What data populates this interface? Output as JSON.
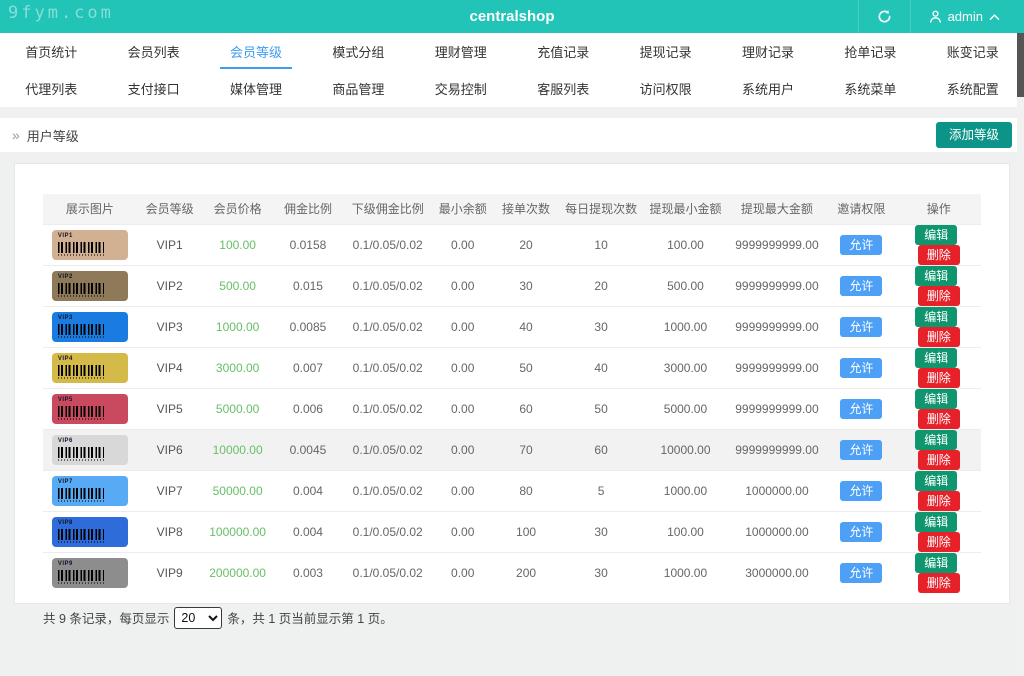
{
  "header": {
    "watermark": "9fym.com",
    "title": "centralshop",
    "user": "admin",
    "brand_color": "#21c4b7"
  },
  "nav": {
    "row1": [
      "首页统计",
      "会员列表",
      "会员等级",
      "模式分组",
      "理财管理",
      "充值记录",
      "提现记录",
      "理财记录",
      "抢单记录",
      "账变记录"
    ],
    "row2": [
      "代理列表",
      "支付接口",
      "媒体管理",
      "商品管理",
      "交易控制",
      "客服列表",
      "访问权限",
      "系统用户",
      "系统菜单",
      "系统配置"
    ],
    "active": "会员等级",
    "active_color": "#3e9ef0"
  },
  "breadcrumb": {
    "marker": "»",
    "label": "用户等级"
  },
  "toolbar": {
    "add_button": "添加等级",
    "add_button_color": "#0d9488"
  },
  "table": {
    "columns": [
      "展示图片",
      "会员等级",
      "会员价格",
      "佣金比例",
      "下级佣金比例",
      "最小余额",
      "接单次数",
      "每日提现次数",
      "提现最小金额",
      "提现最大金额",
      "邀请权限",
      "操作"
    ],
    "actions": {
      "invite": "允许",
      "edit": "编辑",
      "delete": "删除"
    },
    "action_colors": {
      "invite": "#4da0f5",
      "edit": "#10966f",
      "delete": "#e62129"
    },
    "price_color": "#67bf67",
    "rows": [
      {
        "level": "VIP1",
        "price": "100.00",
        "commission": "0.0158",
        "sub_commission": "0.1/0.05/0.02",
        "min_balance": "0.00",
        "orders": "20",
        "daily_withdraw": "10",
        "min_withdraw": "100.00",
        "max_withdraw": "9999999999.00",
        "card_color": "#d2b193",
        "highlight": false
      },
      {
        "level": "VIP2",
        "price": "500.00",
        "commission": "0.015",
        "sub_commission": "0.1/0.05/0.02",
        "min_balance": "0.00",
        "orders": "30",
        "daily_withdraw": "20",
        "min_withdraw": "500.00",
        "max_withdraw": "9999999999.00",
        "card_color": "#8e7a58",
        "highlight": false
      },
      {
        "level": "VIP3",
        "price": "1000.00",
        "commission": "0.0085",
        "sub_commission": "0.1/0.05/0.02",
        "min_balance": "0.00",
        "orders": "40",
        "daily_withdraw": "30",
        "min_withdraw": "1000.00",
        "max_withdraw": "9999999999.00",
        "card_color": "#1a7ce0",
        "highlight": false
      },
      {
        "level": "VIP4",
        "price": "3000.00",
        "commission": "0.007",
        "sub_commission": "0.1/0.05/0.02",
        "min_balance": "0.00",
        "orders": "50",
        "daily_withdraw": "40",
        "min_withdraw": "3000.00",
        "max_withdraw": "9999999999.00",
        "card_color": "#d4ba49",
        "highlight": false
      },
      {
        "level": "VIP5",
        "price": "5000.00",
        "commission": "0.006",
        "sub_commission": "0.1/0.05/0.02",
        "min_balance": "0.00",
        "orders": "60",
        "daily_withdraw": "50",
        "min_withdraw": "5000.00",
        "max_withdraw": "9999999999.00",
        "card_color": "#c94a5e",
        "highlight": false
      },
      {
        "level": "VIP6",
        "price": "10000.00",
        "commission": "0.0045",
        "sub_commission": "0.1/0.05/0.02",
        "min_balance": "0.00",
        "orders": "70",
        "daily_withdraw": "60",
        "min_withdraw": "10000.00",
        "max_withdraw": "9999999999.00",
        "card_color": "#d8d8d8",
        "highlight": true
      },
      {
        "level": "VIP7",
        "price": "50000.00",
        "commission": "0.004",
        "sub_commission": "0.1/0.05/0.02",
        "min_balance": "0.00",
        "orders": "80",
        "daily_withdraw": "5",
        "min_withdraw": "1000.00",
        "max_withdraw": "1000000.00",
        "card_color": "#58aaf4",
        "highlight": false
      },
      {
        "level": "VIP8",
        "price": "100000.00",
        "commission": "0.004",
        "sub_commission": "0.1/0.05/0.02",
        "min_balance": "0.00",
        "orders": "100",
        "daily_withdraw": "30",
        "min_withdraw": "100.00",
        "max_withdraw": "1000000.00",
        "card_color": "#2d6cd9",
        "highlight": false
      },
      {
        "level": "VIP9",
        "price": "200000.00",
        "commission": "0.003",
        "sub_commission": "0.1/0.05/0.02",
        "min_balance": "0.00",
        "orders": "200",
        "daily_withdraw": "30",
        "min_withdraw": "1000.00",
        "max_withdraw": "3000000.00",
        "card_color": "#8d8d8d",
        "highlight": false
      }
    ]
  },
  "pagination": {
    "prefix": "共 9 条记录，每页显示",
    "page_size": "20",
    "suffix": "条，共 1 页当前显示第 1 页。"
  }
}
